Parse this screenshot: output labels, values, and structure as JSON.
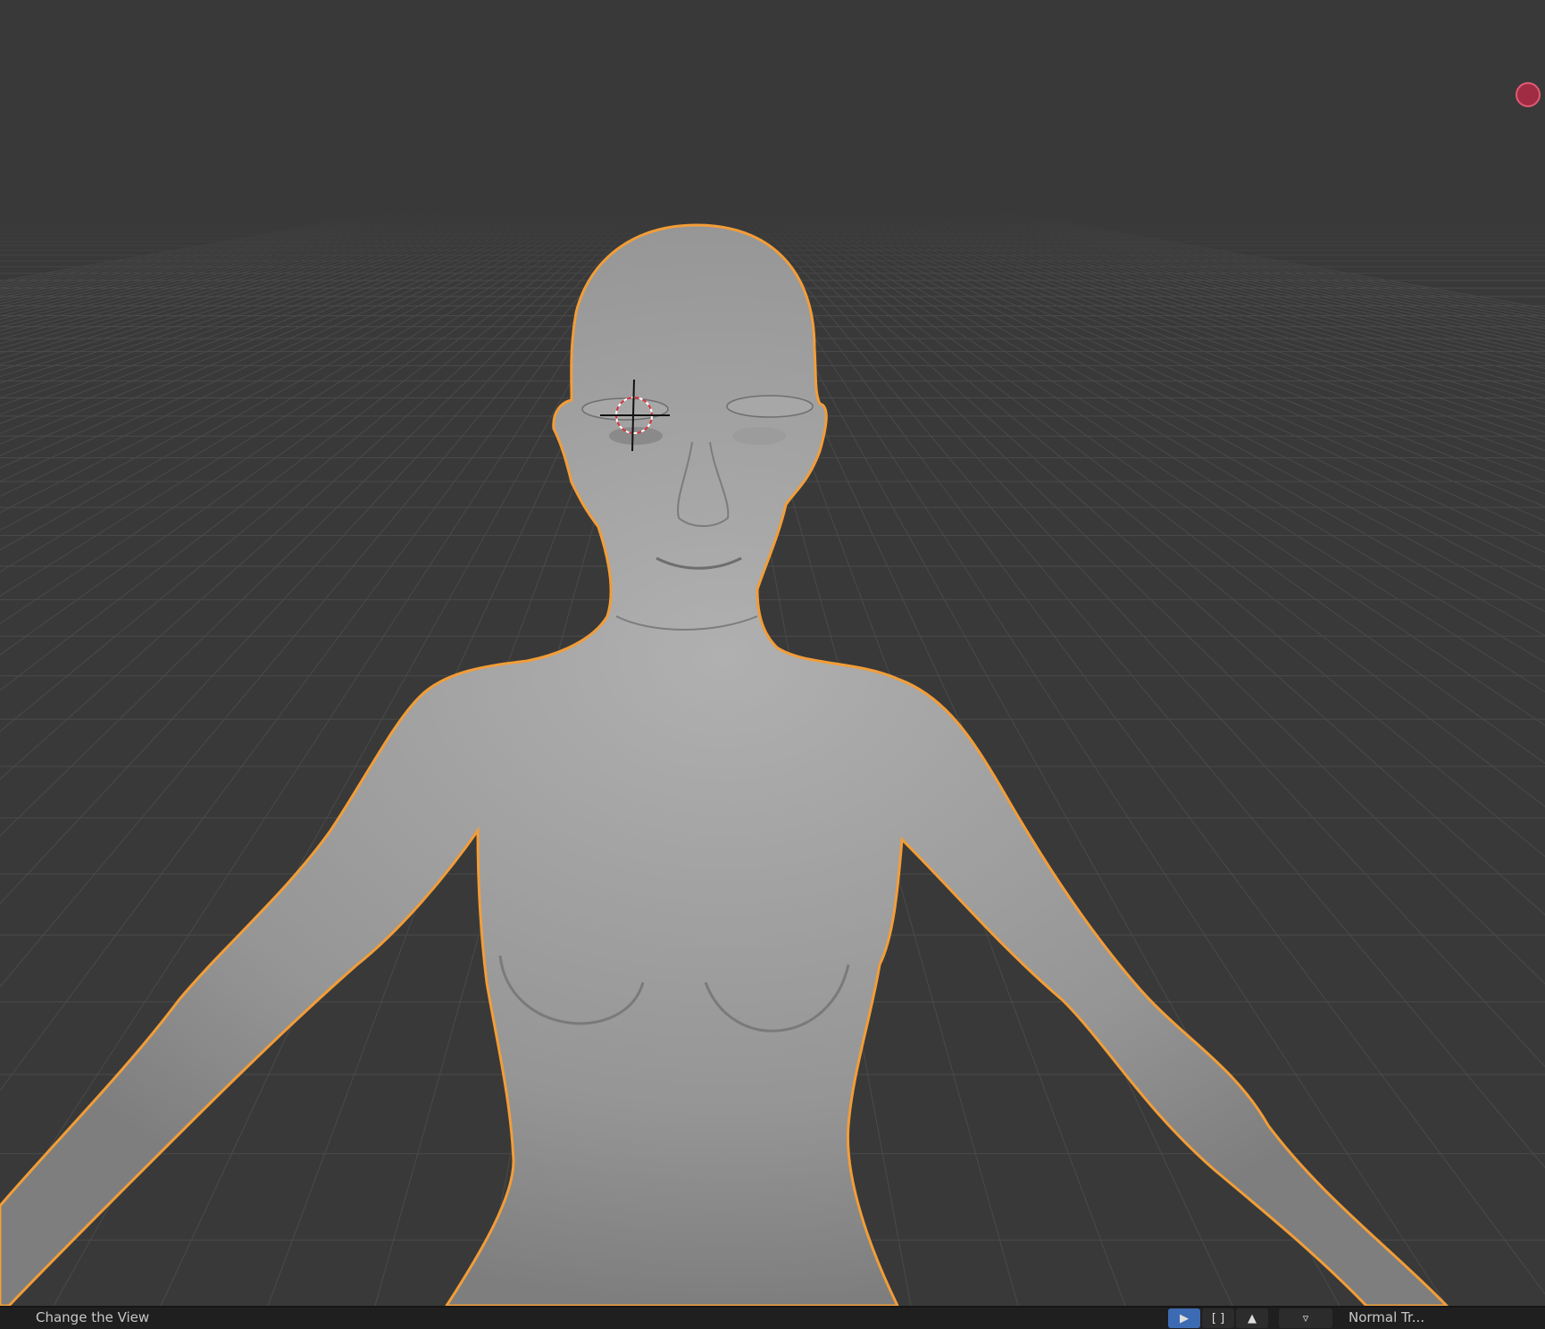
{
  "viewport": {
    "background": "#393939",
    "grid_color": "#4a4a4a",
    "selection_outline_color": "#f29d38",
    "mesh_color": "#9a9a9a",
    "gizmo_color": "#a02c43"
  },
  "statusbar": {
    "left_text": "Change the View",
    "right_text": "Normal Tr..."
  },
  "icons": {
    "cursor_tool": "cursor-icon",
    "select_box_tool": "select-box-icon",
    "tweak_tool": "tweak-icon",
    "filter": "filter-icon",
    "cursor_3d": "3d-cursor-icon",
    "gizmo": "axis-gizmo-icon"
  }
}
